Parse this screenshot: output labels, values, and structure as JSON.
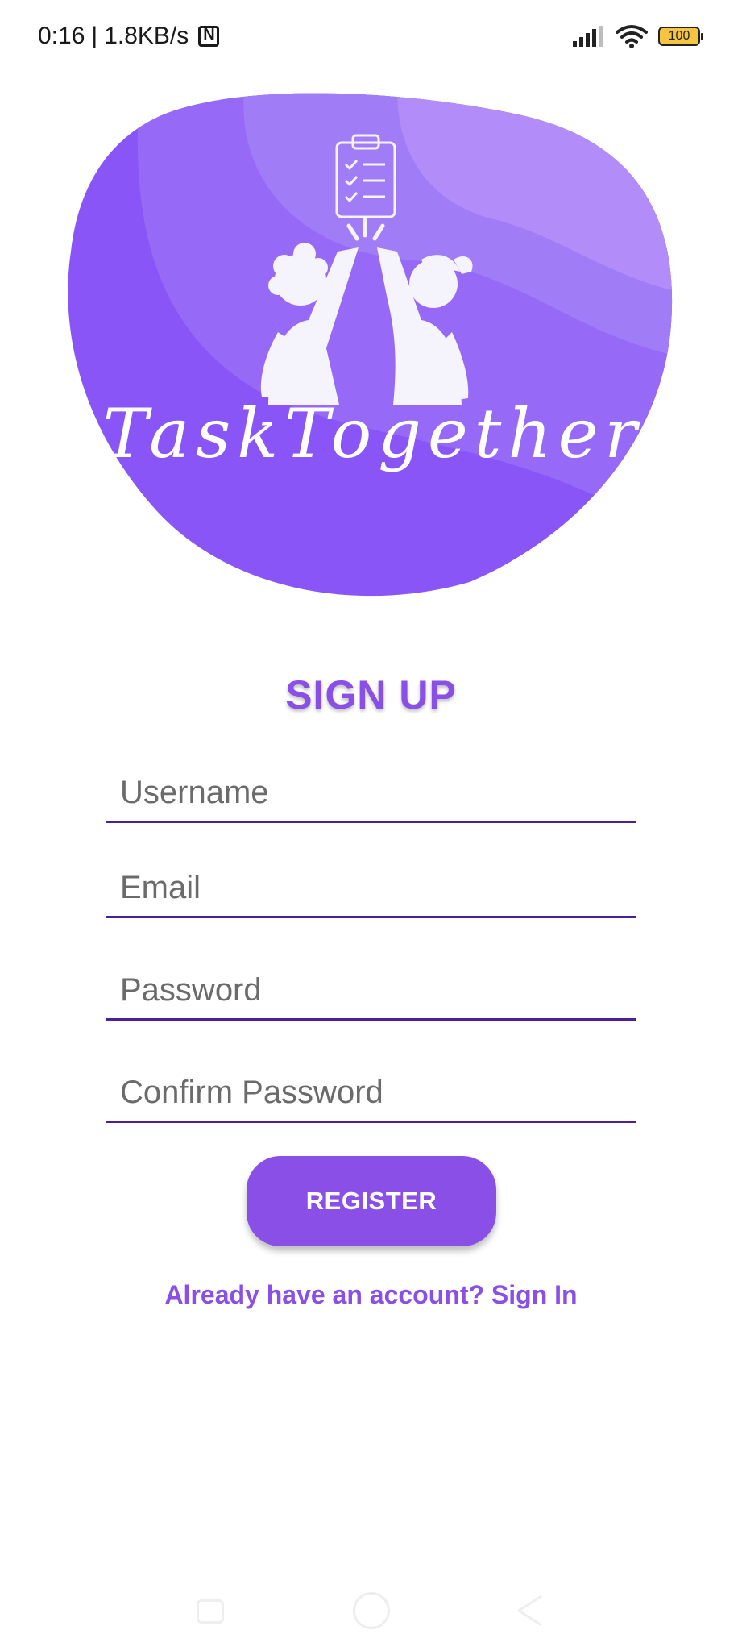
{
  "status_bar": {
    "time": "0:16",
    "separator": "|",
    "network_speed": "1.8KB/s",
    "battery_level": "100",
    "icons": [
      "nfc-icon",
      "signal-icon",
      "wifi-icon",
      "battery-icon"
    ]
  },
  "logo": {
    "app_name": "TaskTogether",
    "colors": {
      "blob_base": "#8a55f6",
      "blob_light": "#a07cf7",
      "blob_lighter": "#b28cf8"
    }
  },
  "form": {
    "title": "SIGN UP",
    "username_placeholder": "Username",
    "email_placeholder": "Email",
    "password_placeholder": "Password",
    "confirm_password_placeholder": "Confirm Password",
    "register_label": "REGISTER",
    "signin_link": "Already have an account? Sign In"
  },
  "colors": {
    "accent": "#8a4fe6",
    "field_underline": "#4a1f9e",
    "placeholder": "#6b6b6b"
  },
  "nav_bar": {
    "icons": [
      "recents-icon",
      "home-icon",
      "back-icon"
    ]
  }
}
